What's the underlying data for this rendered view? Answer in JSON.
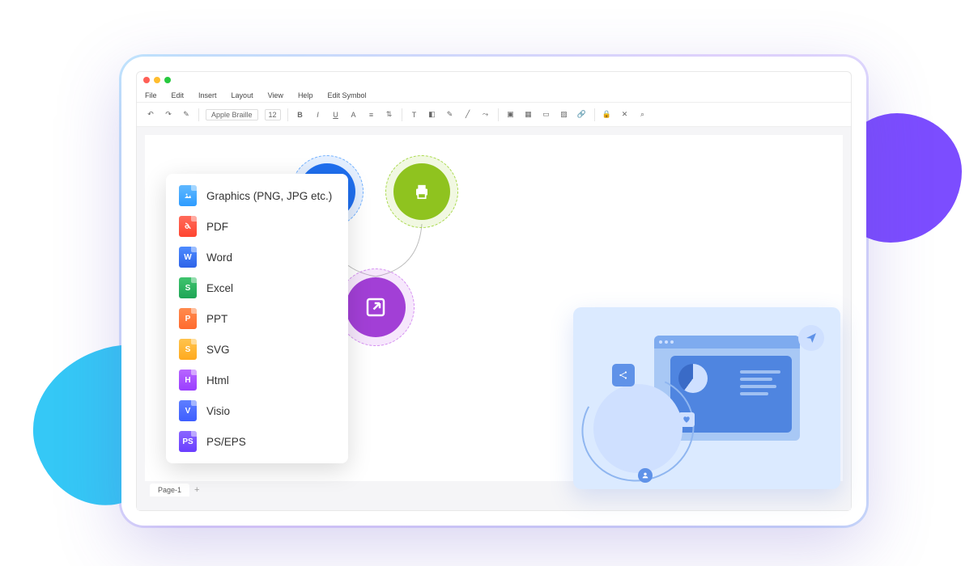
{
  "menu": {
    "file": "File",
    "edit": "Edit",
    "insert": "Insert",
    "layout": "Layout",
    "view": "View",
    "help": "Help",
    "edit_symbol": "Edit Symbol"
  },
  "toolbar": {
    "font_name": "Apple Braille",
    "font_size": "12",
    "bold": "B",
    "italic": "I",
    "underline": "U",
    "text_a": "A"
  },
  "tabs": {
    "page1": "Page-1",
    "add": "+"
  },
  "export": {
    "graphics": "Graphics (PNG, JPG etc.)",
    "pdf": "PDF",
    "word": "Word",
    "excel": "Excel",
    "ppt": "PPT",
    "svg": "SVG",
    "html": "Html",
    "visio": "Visio",
    "ps": "PS/EPS"
  },
  "ficon_labels": {
    "word": "W",
    "excel": "S",
    "ppt": "P",
    "svg": "S",
    "html": "H",
    "visio": "V",
    "ps": "PS"
  }
}
